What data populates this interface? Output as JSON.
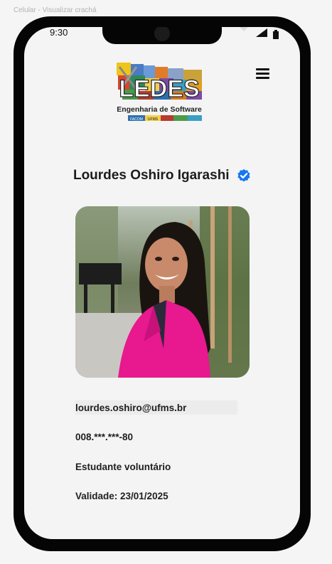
{
  "frame": {
    "title": "Celular - Visualizar crachá"
  },
  "status_bar": {
    "time": "9:30"
  },
  "header": {
    "logo": {
      "text_main": "LEDES",
      "text_sub": "Engenharia de Software",
      "text_badges": [
        "FACOM",
        "UFMS"
      ]
    },
    "menu_icon": "hamburger-menu-icon"
  },
  "profile": {
    "name": "Lourdes Oshiro Igarashi",
    "verified_icon": "verified-check-icon",
    "email": "lourdes.oshiro@ufms.br",
    "cpf": "008.***.***-80",
    "role": "Estudante voluntário",
    "validity": "Validade: 23/01/2025"
  },
  "colors": {
    "verified": "#1877f2",
    "jacket": "#e8188f",
    "background": "#f4f4f4"
  }
}
